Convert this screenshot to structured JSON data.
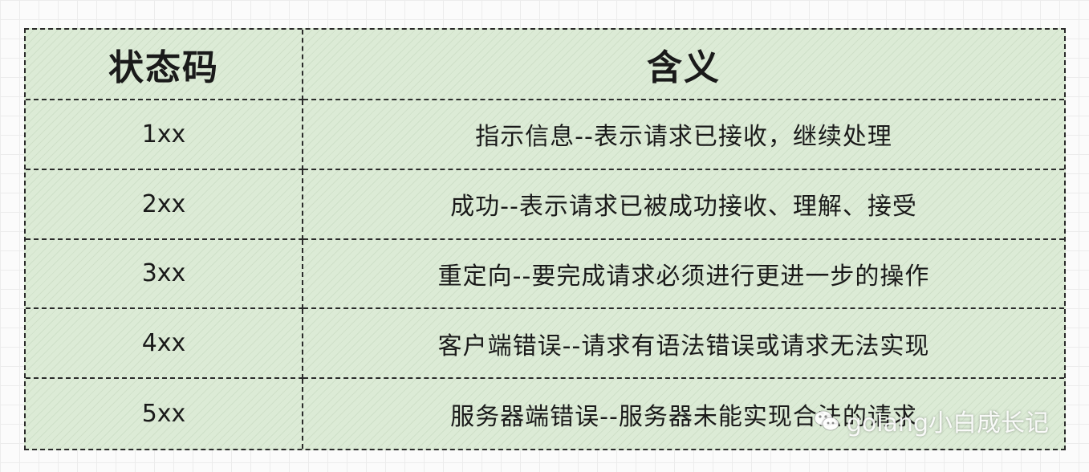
{
  "table": {
    "header": {
      "code": "状态码",
      "meaning": "含义"
    },
    "rows": [
      {
        "code": "1xx",
        "meaning": "指示信息--表示请求已接收，继续处理"
      },
      {
        "code": "2xx",
        "meaning": "成功--表示请求已被成功接收、理解、接受"
      },
      {
        "code": "3xx",
        "meaning": "重定向--要完成请求必须进行更进一步的操作"
      },
      {
        "code": "4xx",
        "meaning": "客户端错误--请求有语法错误或请求无法实现"
      },
      {
        "code": "5xx",
        "meaning": "服务器端错误--服务器未能实现合法的请求"
      }
    ]
  },
  "watermark": {
    "text": "golang小白成长记",
    "icon": "wechat-icon"
  },
  "colors": {
    "cell_fill": "#dcebd6",
    "border": "#2a2a2a",
    "text": "#1a1a1a",
    "grid_background": "#fbfbfb"
  }
}
